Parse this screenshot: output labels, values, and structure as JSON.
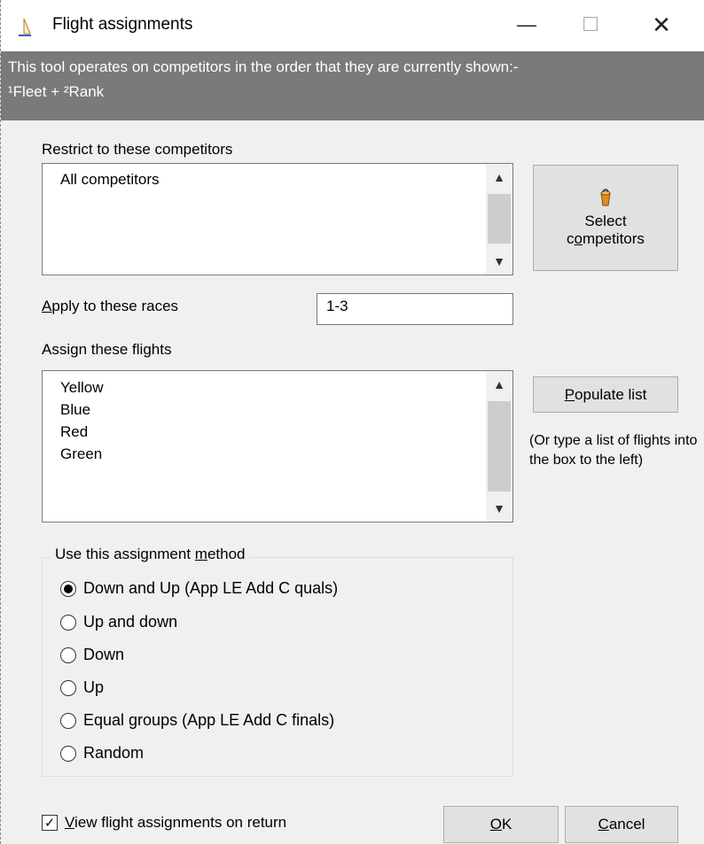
{
  "window": {
    "title": "Flight assignments",
    "controls": {
      "minimize": "—",
      "maximize": "☐",
      "close": "✕"
    }
  },
  "banner": {
    "line1": "This tool operates on competitors in the order that they are currently shown:-",
    "line2": "¹Fleet + ²Rank"
  },
  "competitors": {
    "label": "Restrict to these competitors",
    "items": [
      "All competitors"
    ],
    "select_button": {
      "line1": "Select",
      "line2_pre": "c",
      "line2_u": "o",
      "line2_post": "mpetitors"
    }
  },
  "races": {
    "label_u": "A",
    "label_rest": "pply to these races",
    "value": "1-3"
  },
  "flights": {
    "label": "Assign these flights",
    "items": [
      "Yellow",
      "Blue",
      "Red",
      "Green"
    ],
    "populate_button": {
      "u": "P",
      "rest": "opulate list"
    },
    "hint": "(Or type a list of flights into the box to the left)"
  },
  "method": {
    "legend_pre": "Use this assignment ",
    "legend_u": "m",
    "legend_post": "ethod",
    "options": [
      {
        "label": "Down and Up (App LE Add C quals)",
        "selected": true
      },
      {
        "label": "Up and down",
        "selected": false
      },
      {
        "label": "Down",
        "selected": false
      },
      {
        "label": "Up",
        "selected": false
      },
      {
        "label": "Equal groups (App LE Add C finals)",
        "selected": false
      },
      {
        "label": "Random",
        "selected": false
      }
    ]
  },
  "footer": {
    "checkbox": {
      "u": "V",
      "rest": "iew flight assignments on return",
      "checked": true
    },
    "ok": {
      "u": "O",
      "rest": "K"
    },
    "cancel": {
      "u": "C",
      "rest": "ancel"
    }
  },
  "colors": {
    "banner": "#7a7a7a",
    "background": "#f0f0f0",
    "button": "#e1e1e1"
  }
}
